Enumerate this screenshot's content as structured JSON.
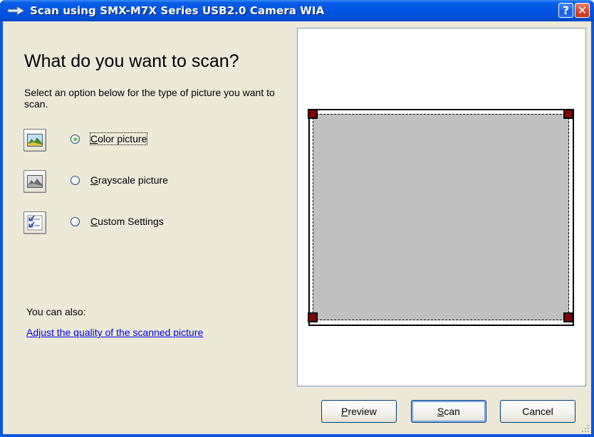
{
  "window": {
    "title": "Scan using SMX-M7X Series USB2.0 Camera WIA",
    "help_glyph": "?",
    "close_glyph": "✕",
    "title_icon": "scanner-arrow-icon"
  },
  "main": {
    "heading": "What do you want to scan?",
    "instructions": "Select an option below for the type of picture you want to scan.",
    "selected_option": "color",
    "options": [
      {
        "id": "color",
        "accel": "C",
        "label_rest": "olor picture",
        "icon": "color-picture-icon",
        "checked": true
      },
      {
        "id": "grayscale",
        "accel": "G",
        "label_rest": "rayscale picture",
        "icon": "grayscale-picture-icon",
        "checked": false
      },
      {
        "id": "custom",
        "accel": "C",
        "label_rest": "ustom Settings",
        "icon": "custom-settings-icon",
        "checked": false
      }
    ],
    "also_label": "You can also:",
    "quality_link": "Adjust the quality of the scanned picture"
  },
  "buttons": {
    "preview_accel": "P",
    "preview_rest": "review",
    "scan_accel": "S",
    "scan_rest": "can",
    "cancel": "Cancel"
  },
  "colors": {
    "titlebar": "#0054e3",
    "window_bg": "#ece9d8",
    "scan_region": "#c0c0c0",
    "handle": "#880000",
    "link": "#0000ee"
  }
}
